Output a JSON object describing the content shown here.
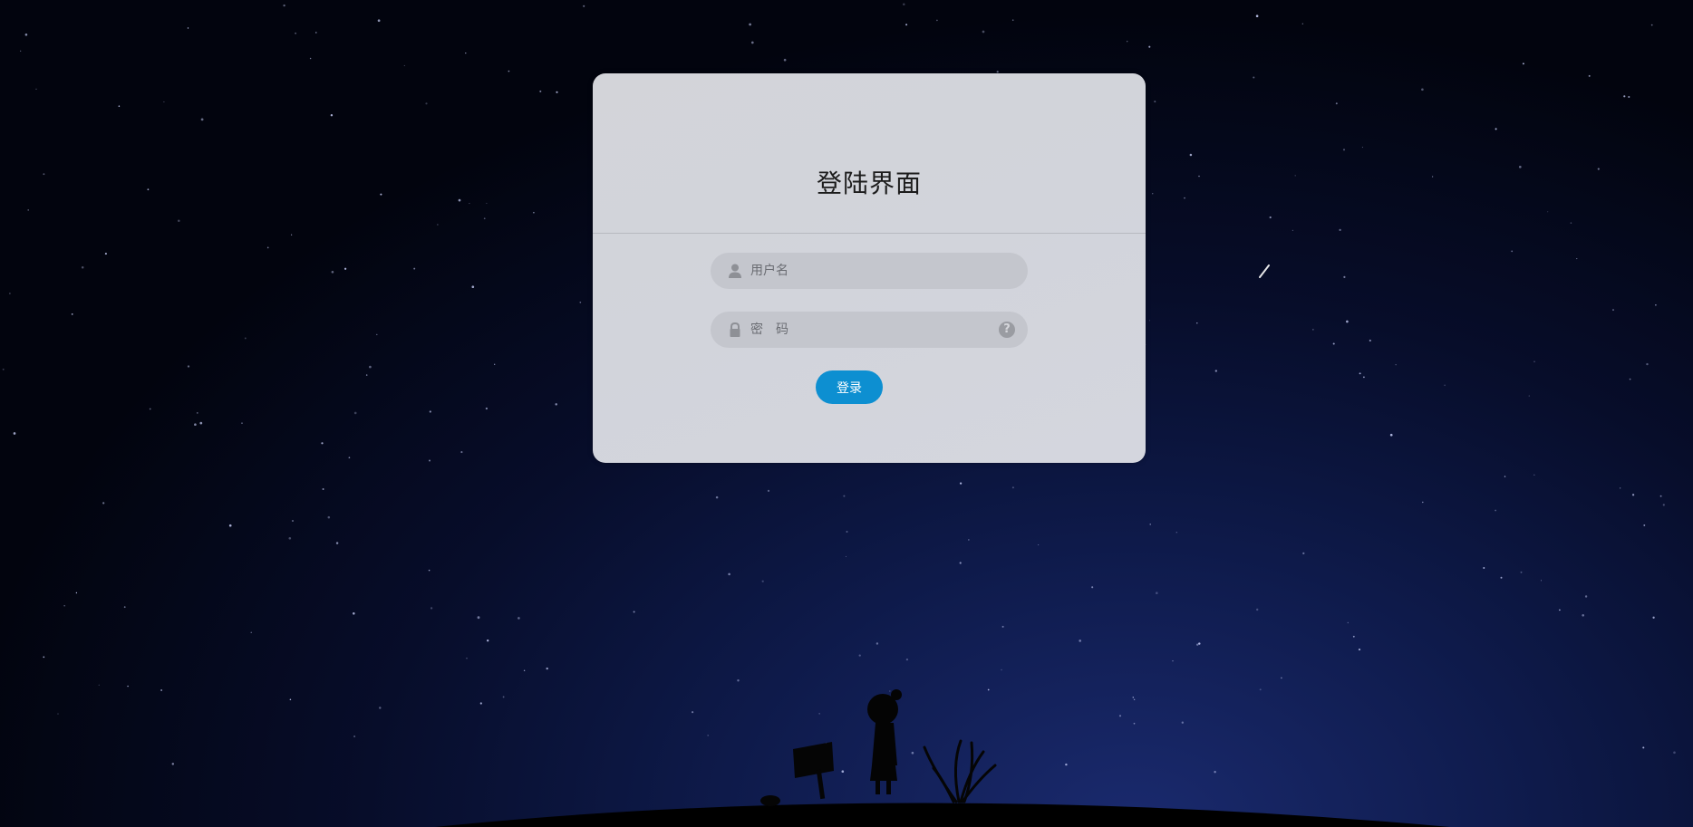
{
  "login": {
    "title": "登陆界面",
    "username_placeholder": "用户名",
    "password_placeholder": "密　码",
    "help_symbol": "?",
    "login_label": "登录",
    "button_color": "#0d8fd1"
  },
  "icons": {
    "username": "user-icon",
    "password": "lock-icon",
    "help": "question-circle-icon"
  }
}
